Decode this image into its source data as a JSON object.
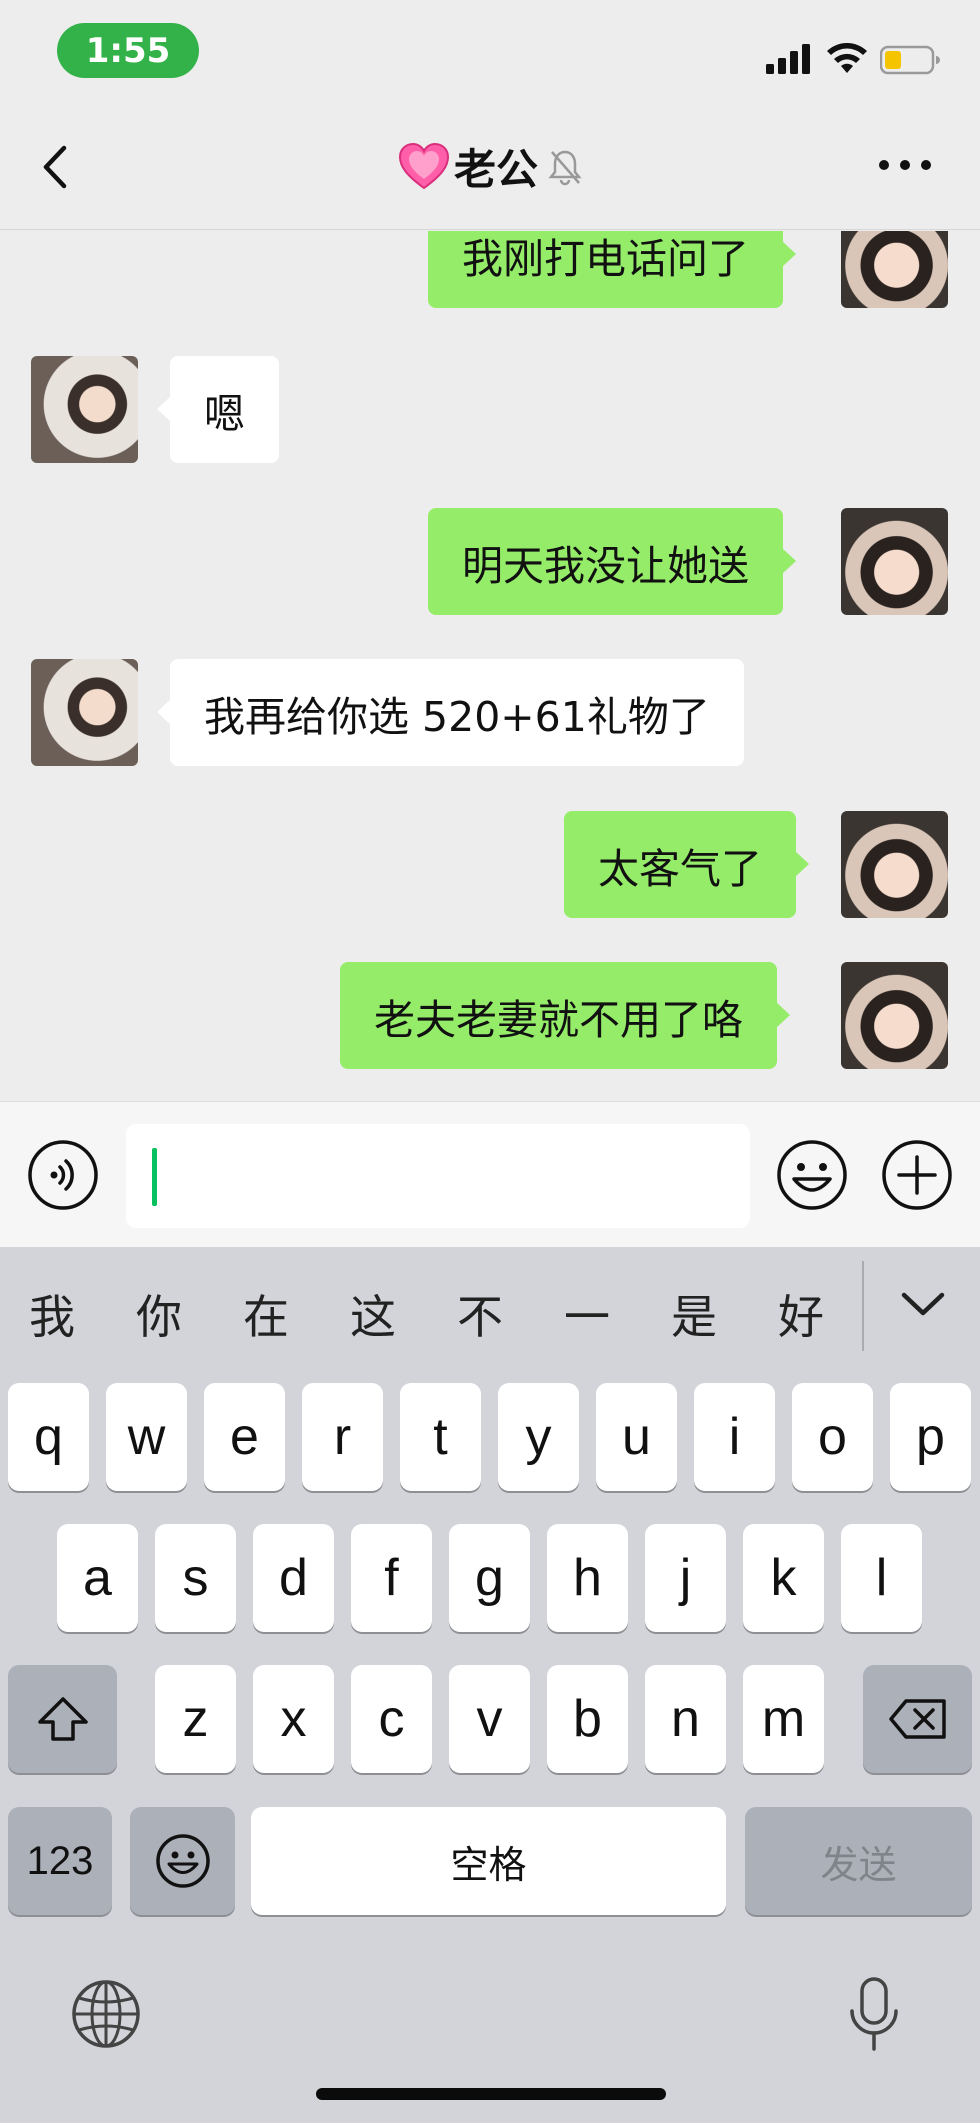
{
  "status_bar": {
    "time": "1:55"
  },
  "header": {
    "title": "老公"
  },
  "messages": [
    {
      "side": "me",
      "text": "我刚打电话问了"
    },
    {
      "side": "him",
      "text": "嗯"
    },
    {
      "side": "me",
      "text": "明天我没让她送"
    },
    {
      "side": "him",
      "text": "我再给你选 520+61礼物了"
    },
    {
      "side": "me",
      "text": "太客气了"
    },
    {
      "side": "me",
      "text": "老夫老妻就不用了咯"
    }
  ],
  "input": {
    "value": ""
  },
  "keyboard": {
    "candidates": [
      "我",
      "你",
      "在",
      "这",
      "不",
      "一",
      "是",
      "好"
    ],
    "row1": [
      "q",
      "w",
      "e",
      "r",
      "t",
      "y",
      "u",
      "i",
      "o",
      "p"
    ],
    "row2": [
      "a",
      "s",
      "d",
      "f",
      "g",
      "h",
      "j",
      "k",
      "l"
    ],
    "row3": [
      "z",
      "x",
      "c",
      "v",
      "b",
      "n",
      "m"
    ],
    "numbers_key": "123",
    "space_key": "空格",
    "send_key": "发送"
  },
  "icons": {
    "back": "back-chevron-icon",
    "heart": "heart-icon",
    "mute": "mute-bell-icon",
    "more": "more-dots-icon",
    "voice": "voice-icon",
    "emoji": "emoji-icon",
    "plus": "plus-icon",
    "shift": "shift-icon",
    "delete": "delete-icon",
    "globe": "globe-icon",
    "mic": "microphone-icon"
  },
  "colors": {
    "my_bubble": "#95ec69",
    "their_bubble": "#ffffff",
    "time_pill": "#34b24a",
    "caret": "#07c160",
    "battery_level": "#f5c400"
  }
}
